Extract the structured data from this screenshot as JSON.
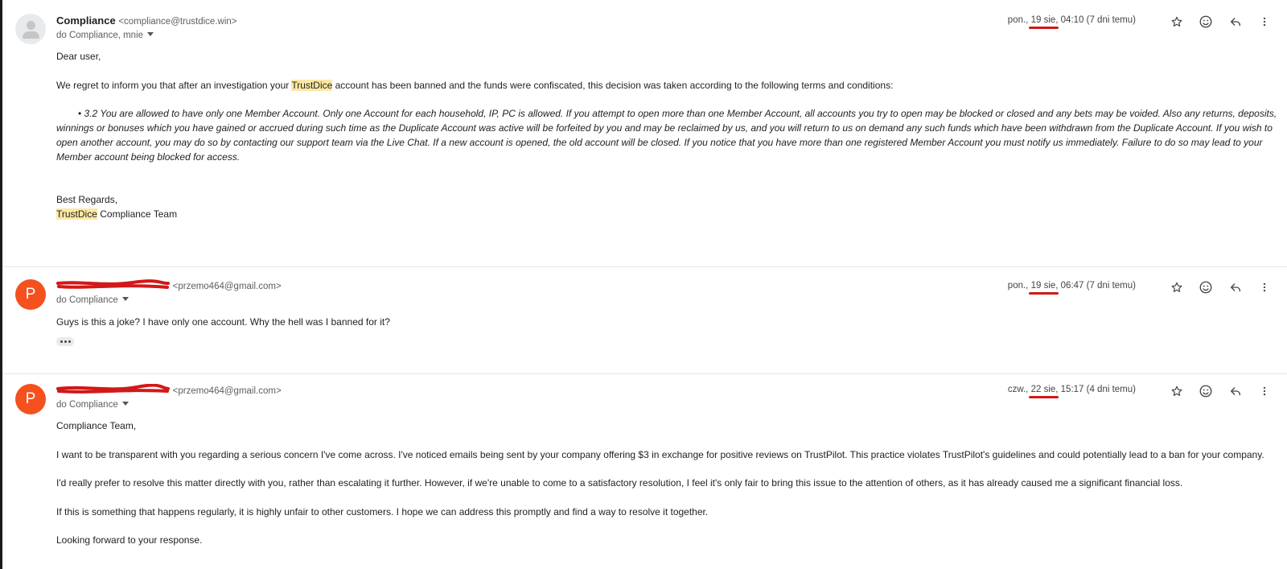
{
  "messages": [
    {
      "avatar_letter": "",
      "sender_name": "Compliance",
      "sender_email": "<compliance@trustdice.win>",
      "recipients": "do Compliance, mnie",
      "date_prefix": "pon., ",
      "date_highlight": "19 sie",
      "date_suffix": ", 04:10 (7 dni temu)",
      "body": {
        "greeting": "Dear user,",
        "para1_before": "We regret to inform you that after an investigation your ",
        "para1_highlight": "TrustDice",
        "para1_after": " account has been banned and the funds were confiscated, this decision was taken according to the following terms and conditions:",
        "terms_bullet": "• ",
        "terms_text": "3.2 You are allowed to have only one Member Account. Only one Account for each household, IP, PC is allowed. If you attempt to open more than one Member Account, all accounts you try to open may be blocked or closed and any bets may be voided. Also any returns, deposits, winnings or bonuses which you have gained or accrued during such time as the Duplicate Account was active will be forfeited by you and may be reclaimed by us, and you will return to us on demand any such funds which have been withdrawn from the Duplicate Account. If you wish to open another account, you may do so by contacting our support team via the Live Chat. If a new account is opened, the old account will be closed. If you notice that you have more than one registered Member Account you must notify us immediately. Failure to do so may lead to your Member account being blocked for access.",
        "closing": "Best Regards,",
        "sig_highlight": "TrustDice",
        "sig_after": " Compliance Team"
      }
    },
    {
      "avatar_letter": "P",
      "sender_name": "",
      "sender_email": "<przemo464@gmail.com>",
      "recipients": "do Compliance",
      "date_prefix": "pon., ",
      "date_highlight": "19 sie",
      "date_suffix": ", 06:47 (7 dni temu)",
      "body": {
        "line1": "Guys is this a joke? I have only one account. Why the hell was I banned for it?"
      }
    },
    {
      "avatar_letter": "P",
      "sender_name": "",
      "sender_email": "<przemo464@gmail.com>",
      "recipients": "do Compliance",
      "date_prefix": "czw., ",
      "date_highlight": "22 sie",
      "date_suffix": ", 15:17 (4 dni temu)",
      "body": {
        "greeting": "Compliance Team,",
        "para1": "I want to be transparent with you regarding a serious concern I've come across. I've noticed emails being sent by your company offering $3 in exchange for positive reviews on TrustPilot. This practice violates TrustPilot's guidelines and could potentially lead to a ban for your company.",
        "para2": "I'd really prefer to resolve this matter directly with you, rather than escalating it further. However, if we're unable to come to a satisfactory resolution, I feel it's only fair to bring this issue to the attention of others, as it has already caused me a significant financial loss.",
        "para3": "If this is something that happens regularly, it is highly unfair to other customers. I hope we can address this promptly and find a way to resolve it together.",
        "para4": "Looking forward to your response."
      }
    }
  ],
  "colors": {
    "avatar_orange": "#f4511e",
    "highlight": "#fce8a4",
    "red_annotation": "#d21818"
  },
  "icons": [
    "star-icon",
    "emoji-icon",
    "reply-icon",
    "more-vert-icon"
  ]
}
